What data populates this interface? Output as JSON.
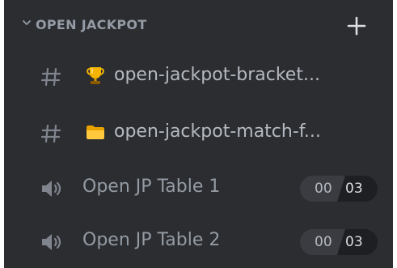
{
  "category": {
    "label": "OPEN JACKPOT"
  },
  "channels": [
    {
      "type": "text",
      "icon": "hash-icon",
      "emoji": "trophy-icon",
      "name": "open-jackpot-bracket..."
    },
    {
      "type": "text",
      "icon": "hash-icon",
      "emoji": "folder-icon",
      "name": "open-jackpot-match-f..."
    },
    {
      "type": "voice",
      "icon": "speaker-icon",
      "name": "Open JP Table 1",
      "user_count": "00",
      "user_limit": "03"
    },
    {
      "type": "voice",
      "icon": "speaker-icon",
      "name": "Open JP Table 2",
      "user_count": "00",
      "user_limit": "03"
    }
  ],
  "colors": {
    "background": "#2b2d31",
    "muted_text": "#949ba4",
    "channel_text": "#b5bac1"
  }
}
